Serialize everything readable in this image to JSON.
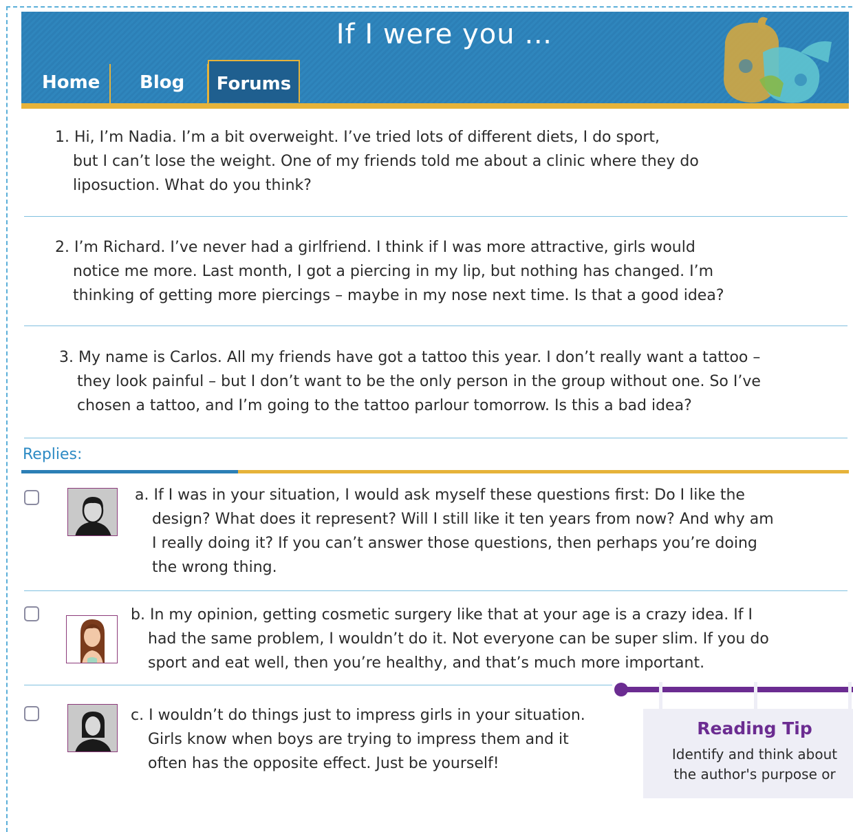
{
  "header": {
    "title": "If I were you …",
    "tabs": [
      "Home",
      "Blog",
      "Forums"
    ]
  },
  "posts": [
    {
      "lines": [
        "1. Hi, I’m Nadia. I’m a bit overweight. I’ve tried lots of different diets, I do sport,",
        "but I can’t lose the weight. One of my friends told me about a clinic where they do",
        "liposuction. What do you think?"
      ]
    },
    {
      "lines": [
        "2. I’m Richard. I’ve never had a girlfriend. I think if I was more attractive, girls would",
        "notice me more. Last month, I got a piercing in my lip, but nothing has changed. I’m",
        "thinking of getting more piercings – maybe in my nose next time. Is that a good idea?"
      ]
    },
    {
      "lines": [
        "3. My name is Carlos. All my friends have got a tattoo this year. I don’t really want a tattoo –",
        "they look painful – but I don’t want to be the only person in the group without one. So I’ve",
        "chosen a tattoo, and I’m going to the tattoo parlour tomorrow. Is this a bad idea?"
      ]
    }
  ],
  "replies_label": "Replies:",
  "replies": [
    {
      "avatar": "man-avatar-icon",
      "lines": [
        "a. If I was in your situation, I would ask myself these questions first: Do I like the",
        "design? What does it represent? Will I still like it ten years from now? And why am",
        "I really doing it? If you can’t answer those questions, then perhaps you’re doing",
        "the wrong thing."
      ]
    },
    {
      "avatar": "woman-photo-avatar-icon",
      "lines": [
        "b. In my opinion, getting cosmetic surgery like that at your age is a crazy idea. If I",
        "had the same problem, I wouldn’t do it. Not everyone can be super slim. If you do",
        "sport and eat well, then you’re healthy, and that’s much more important."
      ]
    },
    {
      "avatar": "woman-avatar-icon",
      "lines": [
        "c. I wouldn’t do things just to impress girls in your situation.",
        "Girls know when boys are trying to impress them and it",
        "often has the opposite effect. Just be yourself!"
      ]
    }
  ],
  "reading_tip": {
    "title": "Reading Tip",
    "lines": [
      "Identify and think about",
      "the author's purpose or"
    ]
  },
  "colors": {
    "header_blue": "#2c7fb6",
    "accent_gold": "#e6b33a",
    "tip_purple": "#6b2c91",
    "divider_blue": "#7fbfdf"
  }
}
